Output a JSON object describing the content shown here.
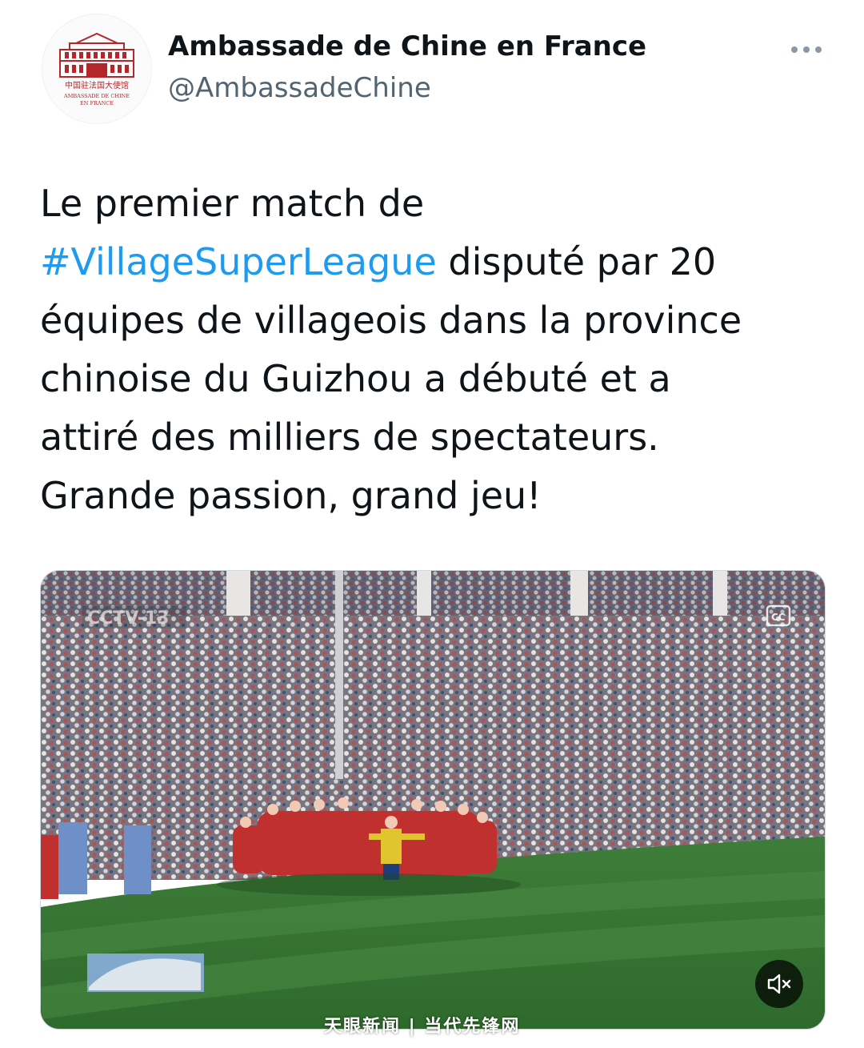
{
  "tweet": {
    "author": {
      "name": "Ambassade de Chine en France",
      "handle": "@AmbassadeChine",
      "avatar": {
        "line_cn": "中国驻法国大使馆",
        "line_fr_1": "AMBASSADE DE CHINE",
        "line_fr_2": "EN FRANCE"
      }
    },
    "more_icon": "more-horizontal-icon",
    "text": {
      "line1": "Le premier match de",
      "hashtag": "#VillageSuperLeague",
      "line2_rest": " disputé par 20",
      "line3": "équipes de villageois dans la province",
      "line4": "chinoise du Guizhou a débuté et a",
      "line5": "attiré des milliers de spectateurs.",
      "line6": "Grande passion, grand jeu!"
    },
    "media": {
      "type": "video",
      "mute_icon": "speaker-muted-icon"
    }
  },
  "watermark": "天眼新闻 | 当代先锋网",
  "colors": {
    "text": "#0f1419",
    "secondary": "#536471",
    "hashtag": "#1d9bf0",
    "logo_red": "#b5262b"
  }
}
